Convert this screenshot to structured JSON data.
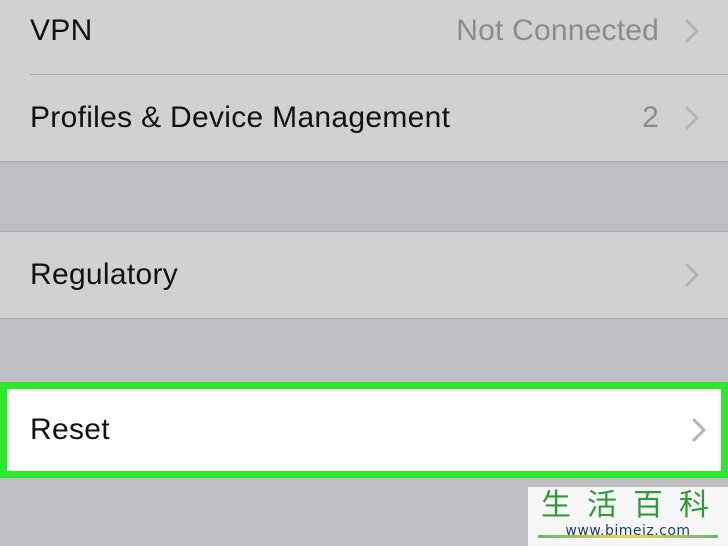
{
  "settings": {
    "rows": [
      {
        "label": "VPN",
        "value": "Not Connected"
      },
      {
        "label": "Profiles & Device Management",
        "value": "2"
      },
      {
        "label": "Regulatory",
        "value": ""
      },
      {
        "label": "Reset",
        "value": ""
      }
    ]
  },
  "icons": {
    "chevron": "chevron-right-icon"
  },
  "colors": {
    "background": "#bfbec3",
    "cell": "#d1d1d3",
    "highlight_border": "#2ee82e",
    "highlight_cell": "#ffffff",
    "value_text": "#8c8c8f",
    "chevron": "#b4b4b8"
  },
  "watermark": {
    "title": "生活百科",
    "url": "www.bimeiz.com"
  }
}
